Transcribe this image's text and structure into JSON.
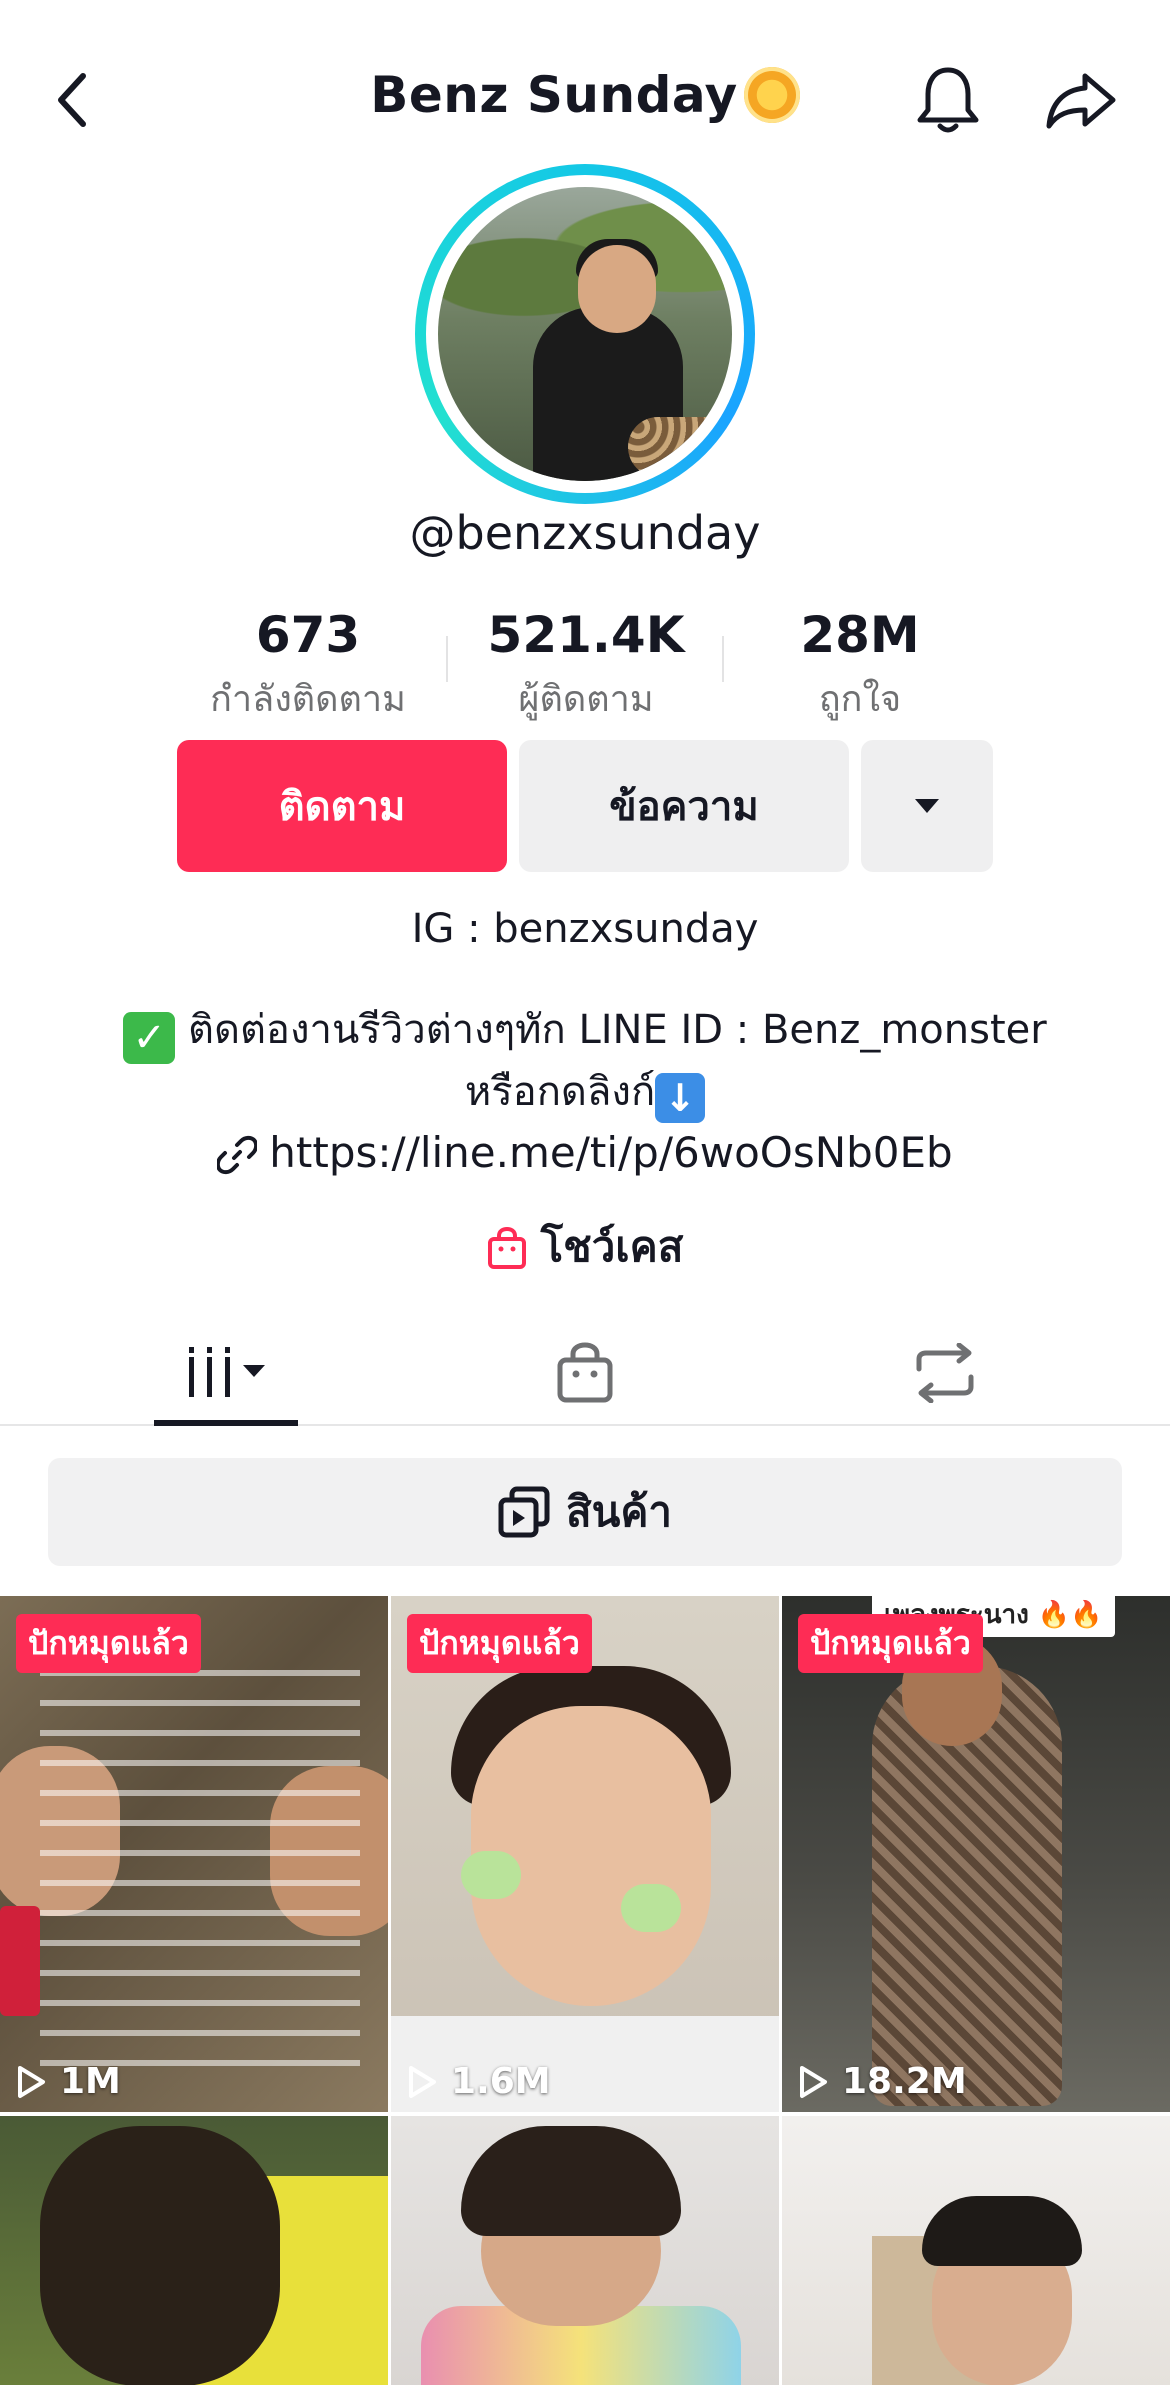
{
  "header": {
    "title": "Benz Sunday",
    "title_emoji": "sun-with-face"
  },
  "profile": {
    "username": "@benzxsunday",
    "stats": [
      {
        "value": "673",
        "label": "กำลังติดตาม"
      },
      {
        "value": "521.4K",
        "label": "ผู้ติดตาม"
      },
      {
        "value": "28M",
        "label": "ถูกใจ"
      }
    ],
    "follow_label": "ติดตาม",
    "message_label": "ข้อความ",
    "bio_ig": "IG : benzxsunday",
    "bio_contact": "ติดต่องานรีวิวต่างๆทัก LINE ID : Benz_monster",
    "bio_contact2": "หรือกดลิงก์",
    "link": "https://line.me/ti/p/6woOsNb0Eb",
    "showcase_label": "โชว์เคส"
  },
  "products_label": "สินค้า",
  "videos": [
    {
      "pinned": "ปักหมุดแล้ว",
      "views": "1M"
    },
    {
      "pinned": "ปักหมุดแล้ว",
      "views": "1.6M"
    },
    {
      "pinned": "ปักหมุดแล้ว",
      "views": "18.2M",
      "overlay": "เพลงพระนาง 🔥🔥"
    },
    {
      "pinned": "",
      "views": ""
    },
    {
      "pinned": "",
      "views": ""
    },
    {
      "pinned": "",
      "views": ""
    }
  ],
  "colors": {
    "accent": "#fe2c55",
    "ring_start": "#14c8e6",
    "ring_end": "#22e0d0",
    "button_grey": "#efeff0"
  },
  "icons": [
    "back-arrow-icon",
    "bell-icon",
    "share-icon",
    "dropdown-caret-icon",
    "link-icon",
    "shopping-bag-icon",
    "videos-grid-icon",
    "shop-tab-icon",
    "repost-icon",
    "products-icon",
    "play-icon"
  ]
}
